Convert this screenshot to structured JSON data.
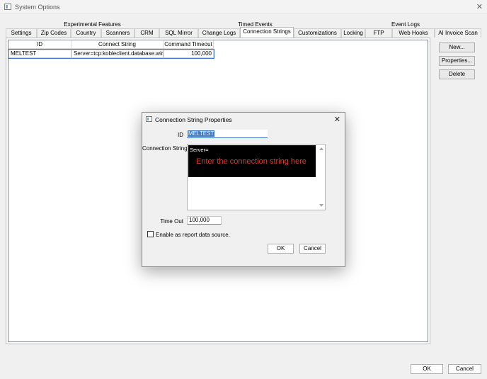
{
  "window": {
    "title": "System Options",
    "close_glyph": "✕"
  },
  "tab_groups": [
    {
      "label": "Experimental Features"
    },
    {
      "label": "Timed Events"
    },
    {
      "label": "Event Logs"
    }
  ],
  "tabs": [
    {
      "label": "Settings"
    },
    {
      "label": "Zip Codes"
    },
    {
      "label": "Country"
    },
    {
      "label": "Scanners"
    },
    {
      "label": "CRM"
    },
    {
      "label": "SQL Mirror"
    },
    {
      "label": "Change Logs"
    },
    {
      "label": "Connection Strings",
      "active": true
    },
    {
      "label": "Customizations"
    },
    {
      "label": "Locking"
    },
    {
      "label": "FTP"
    },
    {
      "label": "Web Hooks"
    },
    {
      "label": "AI Invoice Scan"
    }
  ],
  "grid": {
    "columns": [
      "ID",
      "Connect String",
      "Command Timeout"
    ],
    "rows": [
      {
        "id": "MELTEST",
        "connect_string": "Server=tcp:kobleclient.database.windows",
        "timeout": "100,000"
      }
    ]
  },
  "side_buttons": {
    "new": "New...",
    "properties": "Properties...",
    "delete": "Delete"
  },
  "footer": {
    "ok": "OK",
    "cancel": "Cancel"
  },
  "dialog": {
    "title": "Connection String Properties",
    "close_glyph": "✕",
    "id_label": "ID",
    "id_value": "MELTEST",
    "conn_label": "Connection String:",
    "conn_prefix": "Server=",
    "conn_overlay": "Enter the connection string here",
    "timeout_label": "Time Out",
    "timeout_value": "100,000",
    "report_checkbox_label": "Enable as report data source.",
    "report_checked": false,
    "ok": "OK",
    "cancel": "Cancel"
  },
  "colors": {
    "selection": "#3d79c8",
    "overlay_text": "#e03a2f"
  }
}
